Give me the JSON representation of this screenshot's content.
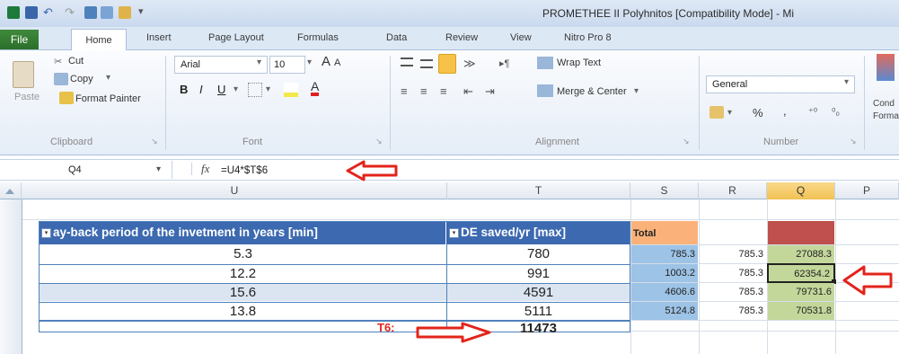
{
  "window": {
    "title": "PROMETHEE II Polyhnitos  [Compatibility Mode] - Mi"
  },
  "tabs": [
    "File",
    "Home",
    "Insert",
    "Page Layout",
    "Formulas",
    "Data",
    "Review",
    "View",
    "Nitro Pro 8"
  ],
  "clipboard": {
    "paste": "Paste",
    "cut": "Cut",
    "copy": "Copy",
    "format_painter": "Format Painter",
    "label": "Clipboard"
  },
  "font": {
    "name": "Arial",
    "size": "10",
    "label": "Font",
    "bold": "B",
    "italic": "I",
    "underline": "U",
    "grow": "A",
    "shrink": "A"
  },
  "alignment": {
    "wrap_text": "Wrap Text",
    "merge_center": "Merge & Center",
    "label": "Alignment"
  },
  "number": {
    "format": "General",
    "percent": "%",
    "comma": ",",
    "label": "Number"
  },
  "styles": {
    "cond_format": "Cond",
    "cond_format2": "Forma"
  },
  "formula_bar": {
    "cell_ref": "Q4",
    "fx": "fx",
    "formula": "=U4*$T$6"
  },
  "columns": [
    "U",
    "T",
    "S",
    "R",
    "Q",
    "P"
  ],
  "table": {
    "header_u": "ay-back period of the invetment in years [min]",
    "header_t": "DE saved/yr [max]",
    "header_s": "Total",
    "rows": [
      {
        "u": "5.3",
        "t": "780",
        "s": "785.3",
        "r": "785.3",
        "q": "27088.3"
      },
      {
        "u": "12.2",
        "t": "991",
        "s": "1003.2",
        "r": "785.3",
        "q": "62354.2"
      },
      {
        "u": "15.6",
        "t": "4591",
        "s": "4606.6",
        "r": "785.3",
        "q": "79731.6"
      },
      {
        "u": "13.8",
        "t": "5111",
        "s": "5124.8",
        "r": "785.3",
        "q": "70531.8"
      }
    ],
    "total_label": "T6:",
    "total_value": "11473"
  },
  "colors": {
    "header_blue": "#3c69b0",
    "band_blue": "#dbe5f1",
    "s_cells": "#9dc3e6",
    "q_cells": "#c4d79b",
    "total_orange": "#fab27a",
    "q_header_red": "#c0504d",
    "arrow_red": "#e3241b"
  }
}
